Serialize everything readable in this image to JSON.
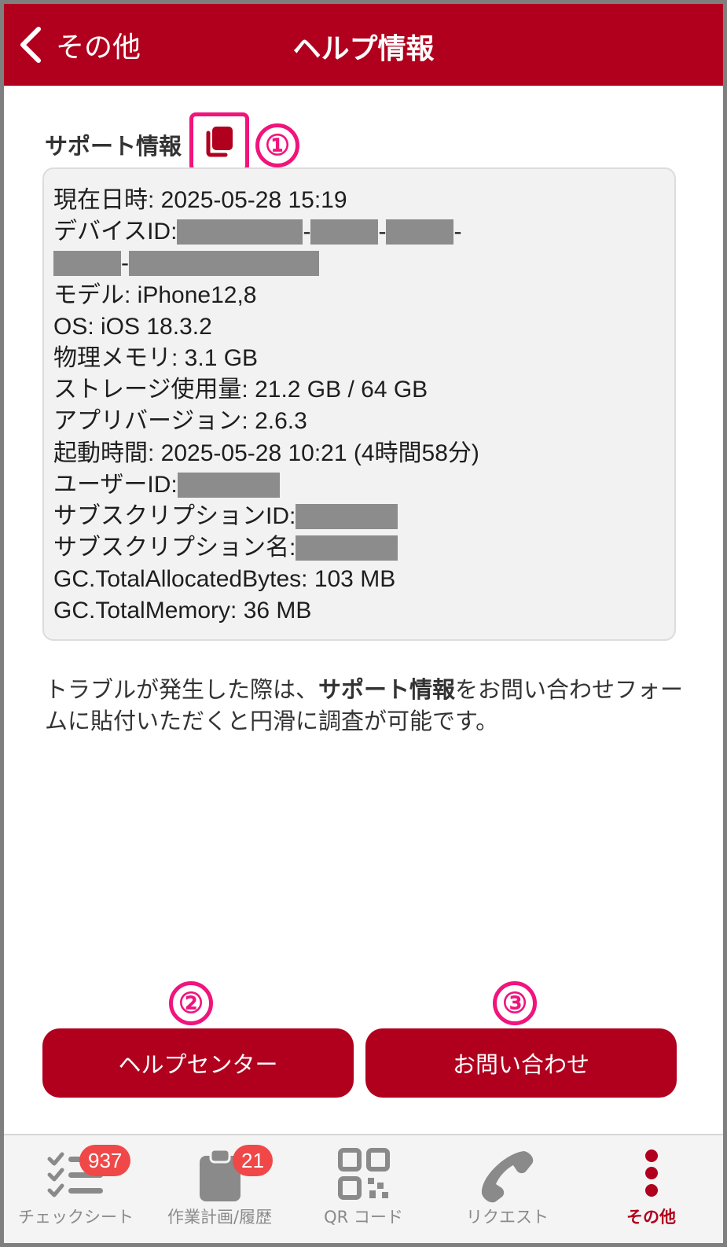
{
  "header": {
    "back_label": "その他",
    "title": "ヘルプ情報"
  },
  "support": {
    "label": "サポート情報",
    "markers": [
      "①",
      "②",
      "③"
    ],
    "lines": {
      "datetime": "現在日時: 2025-05-28 15:19",
      "device_id_label": "デバイスID: ",
      "model": "モデル: iPhone12,8",
      "os": "OS: iOS 18.3.2",
      "memory": "物理メモリ: 3.1 GB",
      "storage": "ストレージ使用量: 21.2 GB / 64 GB",
      "app_version": "アプリバージョン: 2.6.3",
      "uptime": "起動時間: 2025-05-28 10:21 (4時間58分)",
      "user_id_label": "ユーザーID: ",
      "subscription_id_label": "サブスクリプションID: ",
      "subscription_name_label": "サブスクリプション名: ",
      "gc_allocated": "GC.TotalAllocatedBytes: 103 MB",
      "gc_memory": "GC.TotalMemory: 36 MB"
    },
    "separator": "-"
  },
  "description": {
    "part1": "トラブルが発生した際は、",
    "bold": "サポート情報",
    "part2": "をお問い合わせフォームに貼付いただくと円滑に調査が可能です。"
  },
  "buttons": {
    "help_center": "ヘルプセンター",
    "contact": "お問い合わせ"
  },
  "tabbar": {
    "tabs": [
      {
        "label": "チェックシート",
        "badge": "937",
        "icon": "checklist-icon"
      },
      {
        "label": "作業計画/履歴",
        "badge": "21",
        "icon": "clipboard-icon"
      },
      {
        "label": "QR コード",
        "icon": "qr-code-icon"
      },
      {
        "label": "リクエスト",
        "icon": "phone-icon"
      },
      {
        "label": "その他",
        "icon": "more-vertical-icon",
        "active": true
      }
    ]
  },
  "colors": {
    "brand": "#b0001e",
    "highlight": "#f0147c",
    "badge": "#f04848"
  }
}
